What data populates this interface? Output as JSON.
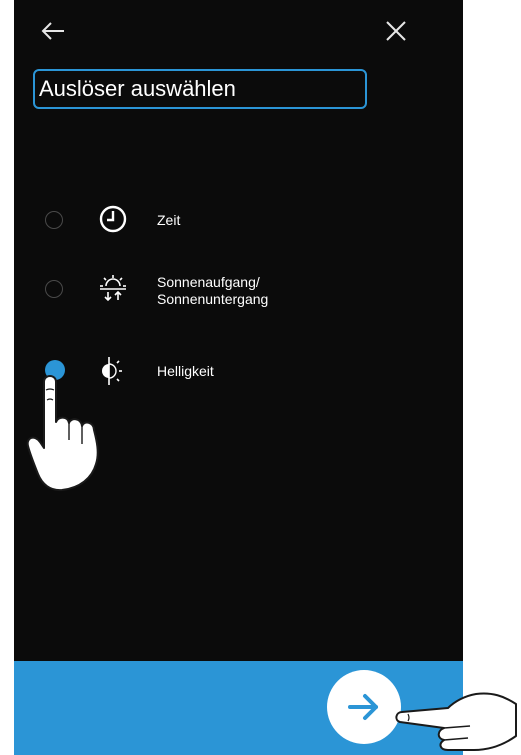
{
  "header": {
    "back_icon": "arrow-left-icon",
    "close_icon": "close-icon",
    "title": "Auslöser auswählen"
  },
  "options": [
    {
      "label": "Zeit",
      "icon": "clock-icon",
      "selected": false
    },
    {
      "label_line1": "Sonnenaufgang/",
      "label_line2": "Sonnenuntergang",
      "icon": "sunrise-sunset-icon",
      "selected": false
    },
    {
      "label": "Helligkeit",
      "icon": "brightness-icon",
      "selected": true
    }
  ],
  "footer": {
    "next_icon": "arrow-right-icon"
  },
  "colors": {
    "background": "#0b0b0b",
    "accent": "#2b95d6",
    "text": "#ffffff"
  }
}
